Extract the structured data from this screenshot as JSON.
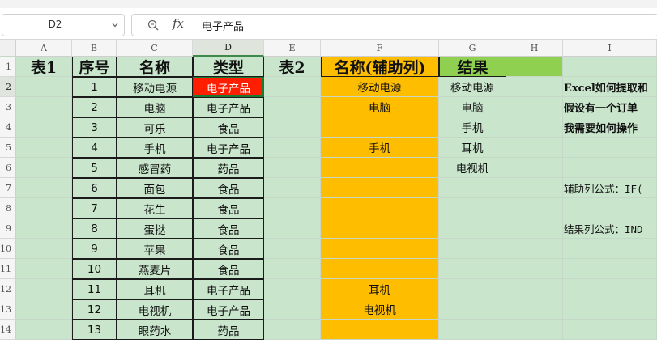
{
  "formula_bar": {
    "name_box": "D2",
    "fx_label": "fx",
    "formula": "电子产品"
  },
  "colors": {
    "grid_fill": "#c9e6cc",
    "helper_fill": "#ffbd00",
    "result_header_fill": "#8fd050",
    "highlight_fill": "#ff1e00",
    "highlight_text": "#ffffff"
  },
  "columns": [
    "A",
    "B",
    "C",
    "D",
    "E",
    "F",
    "G",
    "H",
    "I"
  ],
  "selected_cell": "D2",
  "rows": [
    {
      "num": "1",
      "a": "表1",
      "b": "序号",
      "c": "名称",
      "d": "类型",
      "e": "表2",
      "f": "名称(辅助列)",
      "g": "结果",
      "h": "",
      "i": ""
    },
    {
      "num": "2",
      "a": "",
      "b": "1",
      "c": "移动电源",
      "d": "电子产品",
      "e": "",
      "f": "移动电源",
      "g": "移动电源",
      "h": "",
      "i": "Excel如何提取和"
    },
    {
      "num": "3",
      "a": "",
      "b": "2",
      "c": "电脑",
      "d": "电子产品",
      "e": "",
      "f": "电脑",
      "g": "电脑",
      "h": "",
      "i": "假设有一个订单"
    },
    {
      "num": "4",
      "a": "",
      "b": "3",
      "c": "可乐",
      "d": "食品",
      "e": "",
      "f": "",
      "g": "手机",
      "h": "",
      "i": "我需要如何操作"
    },
    {
      "num": "5",
      "a": "",
      "b": "4",
      "c": "手机",
      "d": "电子产品",
      "e": "",
      "f": "手机",
      "g": "耳机",
      "h": "",
      "i": ""
    },
    {
      "num": "6",
      "a": "",
      "b": "5",
      "c": "感冒药",
      "d": "药品",
      "e": "",
      "f": "",
      "g": "电视机",
      "h": "",
      "i": ""
    },
    {
      "num": "7",
      "a": "",
      "b": "6",
      "c": "面包",
      "d": "食品",
      "e": "",
      "f": "",
      "g": "",
      "h": "",
      "i": "辅助列公式：IF("
    },
    {
      "num": "8",
      "a": "",
      "b": "7",
      "c": "花生",
      "d": "食品",
      "e": "",
      "f": "",
      "g": "",
      "h": "",
      "i": ""
    },
    {
      "num": "9",
      "a": "",
      "b": "8",
      "c": "蛋挞",
      "d": "食品",
      "e": "",
      "f": "",
      "g": "",
      "h": "",
      "i": "结果列公式：IND"
    },
    {
      "num": "10",
      "a": "",
      "b": "9",
      "c": "苹果",
      "d": "食品",
      "e": "",
      "f": "",
      "g": "",
      "h": "",
      "i": ""
    },
    {
      "num": "11",
      "a": "",
      "b": "10",
      "c": "燕麦片",
      "d": "食品",
      "e": "",
      "f": "",
      "g": "",
      "h": "",
      "i": ""
    },
    {
      "num": "12",
      "a": "",
      "b": "11",
      "c": "耳机",
      "d": "电子产品",
      "e": "",
      "f": "耳机",
      "g": "",
      "h": "",
      "i": ""
    },
    {
      "num": "13",
      "a": "",
      "b": "12",
      "c": "电视机",
      "d": "电子产品",
      "e": "",
      "f": "电视机",
      "g": "",
      "h": "",
      "i": ""
    },
    {
      "num": "14",
      "a": "",
      "b": "13",
      "c": "眼药水",
      "d": "药品",
      "e": "",
      "f": "",
      "g": "",
      "h": "",
      "i": ""
    }
  ]
}
